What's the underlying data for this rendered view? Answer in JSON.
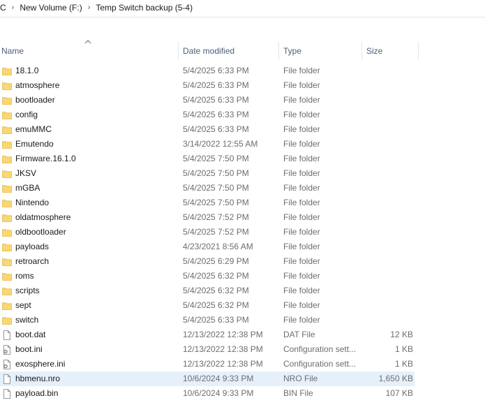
{
  "breadcrumb": {
    "items": [
      "C",
      "New Volume (F:)",
      "Temp Switch backup (5-4)"
    ]
  },
  "columns": {
    "name": "Name",
    "date": "Date modified",
    "type": "Type",
    "size": "Size",
    "sort_icon": "chevron-up-icon"
  },
  "files": [
    {
      "name": "18.1.0",
      "date": "5/4/2025 6:33 PM",
      "type": "File folder",
      "size": "",
      "icon": "folder-icon"
    },
    {
      "name": "atmosphere",
      "date": "5/4/2025 6:33 PM",
      "type": "File folder",
      "size": "",
      "icon": "folder-icon"
    },
    {
      "name": "bootloader",
      "date": "5/4/2025 6:33 PM",
      "type": "File folder",
      "size": "",
      "icon": "folder-icon"
    },
    {
      "name": "config",
      "date": "5/4/2025 6:33 PM",
      "type": "File folder",
      "size": "",
      "icon": "folder-icon"
    },
    {
      "name": "emuMMC",
      "date": "5/4/2025 6:33 PM",
      "type": "File folder",
      "size": "",
      "icon": "folder-icon"
    },
    {
      "name": "Emutendo",
      "date": "3/14/2022 12:55 AM",
      "type": "File folder",
      "size": "",
      "icon": "folder-icon"
    },
    {
      "name": "Firmware.16.1.0",
      "date": "5/4/2025 7:50 PM",
      "type": "File folder",
      "size": "",
      "icon": "folder-icon"
    },
    {
      "name": "JKSV",
      "date": "5/4/2025 7:50 PM",
      "type": "File folder",
      "size": "",
      "icon": "folder-icon"
    },
    {
      "name": "mGBA",
      "date": "5/4/2025 7:50 PM",
      "type": "File folder",
      "size": "",
      "icon": "folder-icon"
    },
    {
      "name": "Nintendo",
      "date": "5/4/2025 7:50 PM",
      "type": "File folder",
      "size": "",
      "icon": "folder-icon"
    },
    {
      "name": "oldatmosphere",
      "date": "5/4/2025 7:52 PM",
      "type": "File folder",
      "size": "",
      "icon": "folder-icon"
    },
    {
      "name": "oldbootloader",
      "date": "5/4/2025 7:52 PM",
      "type": "File folder",
      "size": "",
      "icon": "folder-icon"
    },
    {
      "name": "payloads",
      "date": "4/23/2021 8:56 AM",
      "type": "File folder",
      "size": "",
      "icon": "folder-icon"
    },
    {
      "name": "retroarch",
      "date": "5/4/2025 6:29 PM",
      "type": "File folder",
      "size": "",
      "icon": "folder-icon"
    },
    {
      "name": "roms",
      "date": "5/4/2025 6:32 PM",
      "type": "File folder",
      "size": "",
      "icon": "folder-icon"
    },
    {
      "name": "scripts",
      "date": "5/4/2025 6:32 PM",
      "type": "File folder",
      "size": "",
      "icon": "folder-icon"
    },
    {
      "name": "sept",
      "date": "5/4/2025 6:32 PM",
      "type": "File folder",
      "size": "",
      "icon": "folder-icon"
    },
    {
      "name": "switch",
      "date": "5/4/2025 6:33 PM",
      "type": "File folder",
      "size": "",
      "icon": "folder-icon"
    },
    {
      "name": "boot.dat",
      "date": "12/13/2022 12:38 PM",
      "type": "DAT File",
      "size": "12 KB",
      "icon": "file-icon"
    },
    {
      "name": "boot.ini",
      "date": "12/13/2022 12:38 PM",
      "type": "Configuration sett...",
      "size": "1 KB",
      "icon": "settings-file-icon"
    },
    {
      "name": "exosphere.ini",
      "date": "12/13/2022 12:38 PM",
      "type": "Configuration sett...",
      "size": "1 KB",
      "icon": "settings-file-icon"
    },
    {
      "name": "hbmenu.nro",
      "date": "10/6/2024 9:33 PM",
      "type": "NRO File",
      "size": "1,650 KB",
      "icon": "file-icon",
      "selected": true
    },
    {
      "name": "payload.bin",
      "date": "10/6/2024 9:33 PM",
      "type": "BIN File",
      "size": "107 KB",
      "icon": "file-icon"
    }
  ],
  "colors": {
    "folder": "#f8d775",
    "folder_dark": "#e8b84a",
    "selection": "#e5f0fb",
    "header_text": "#4c607a"
  }
}
